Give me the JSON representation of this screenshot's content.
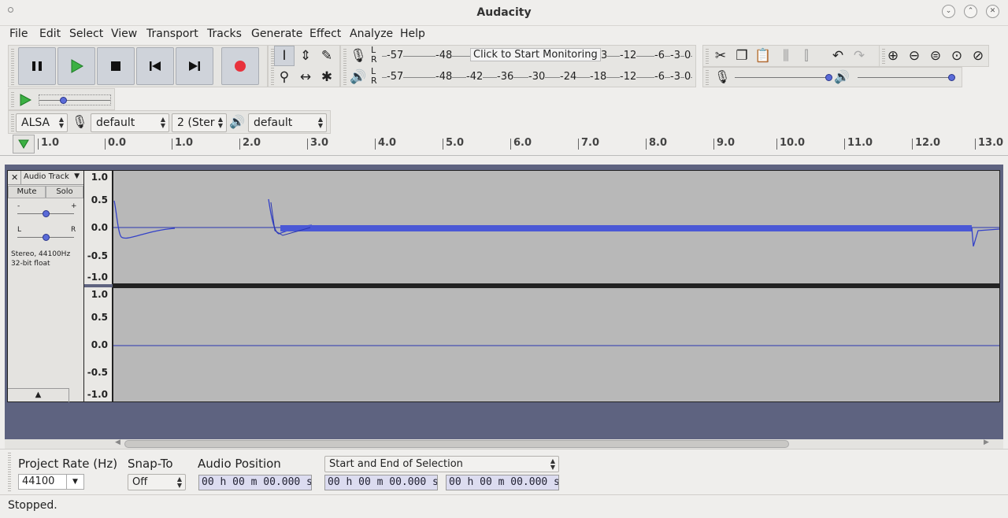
{
  "window": {
    "title": "Audacity"
  },
  "menu": [
    "File",
    "Edit",
    "Select",
    "View",
    "Transport",
    "Tracks",
    "Generate",
    "Effect",
    "Analyze",
    "Help"
  ],
  "meters": {
    "record_scale": [
      "-57",
      "-48",
      "-12",
      "-6",
      "-3",
      "0"
    ],
    "record_tooltip": "Click to Start Monitoring",
    "record_partial": "3",
    "playback_scale": [
      "-57",
      "-48",
      "-42",
      "-36",
      "-30",
      "-24",
      "-18",
      "-12",
      "-6",
      "-3",
      "0"
    ],
    "L": "L",
    "R": "R"
  },
  "device": {
    "host": "ALSA",
    "rec_device": "default",
    "channels": "2 (Ster",
    "play_device": "default"
  },
  "timeline": {
    "ticks": [
      "1.0",
      "0.0",
      "1.0",
      "2.0",
      "3.0",
      "4.0",
      "5.0",
      "6.0",
      "7.0",
      "8.0",
      "9.0",
      "10.0",
      "11.0",
      "12.0",
      "13.0"
    ]
  },
  "track": {
    "name": "Audio Track",
    "mute": "Mute",
    "solo": "Solo",
    "gain_minus": "-",
    "gain_plus": "+",
    "pan_left": "L",
    "pan_right": "R",
    "info1": "Stereo, 44100Hz",
    "info2": "32-bit float",
    "scale": [
      "1.0",
      "0.5",
      "0.0",
      "-0.5",
      "-1.0"
    ]
  },
  "selection_bar": {
    "rate_label": "Project Rate (Hz)",
    "rate_value": "44100",
    "snap_label": "Snap-To",
    "snap_value": "Off",
    "position_label": "Audio Position",
    "selection_mode": "Start and End of Selection",
    "position_time": "00 h 00 m 00.000 s",
    "start_time": "00 h 00 m 00.000 s",
    "end_time": "00 h 00 m 00.000 s"
  },
  "status": {
    "text": "Stopped."
  },
  "colors": {
    "accent_wave": "#3341c8",
    "record_red": "#e8323c",
    "play_green": "#3cb043",
    "knob_blue": "#5a6bd8"
  }
}
